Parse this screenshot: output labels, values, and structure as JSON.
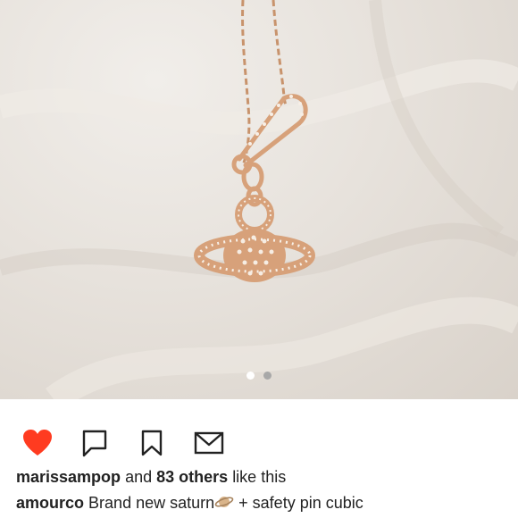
{
  "post": {
    "carousel": {
      "count": 2,
      "active_index": 0
    },
    "colors": {
      "heart": "#ff3b20",
      "icon_stroke": "#222222",
      "dot_active": "#ffffff",
      "dot_inactive": "#a8a8a8",
      "gold": "#d7a17a"
    },
    "actions": {
      "like_icon": "heart-filled-icon",
      "comment_icon": "speech-bubble-icon",
      "save_icon": "bookmark-icon",
      "share_icon": "envelope-icon"
    },
    "likes": {
      "user": "marissampop",
      "and": "and",
      "others": "83 others",
      "suffix": "like this"
    },
    "caption": {
      "user": "amourco",
      "text_part1": "Brand new saturn",
      "emoji_icon": "ringed-planet-emoji",
      "text_part2": "+ safety pin cubic"
    }
  }
}
